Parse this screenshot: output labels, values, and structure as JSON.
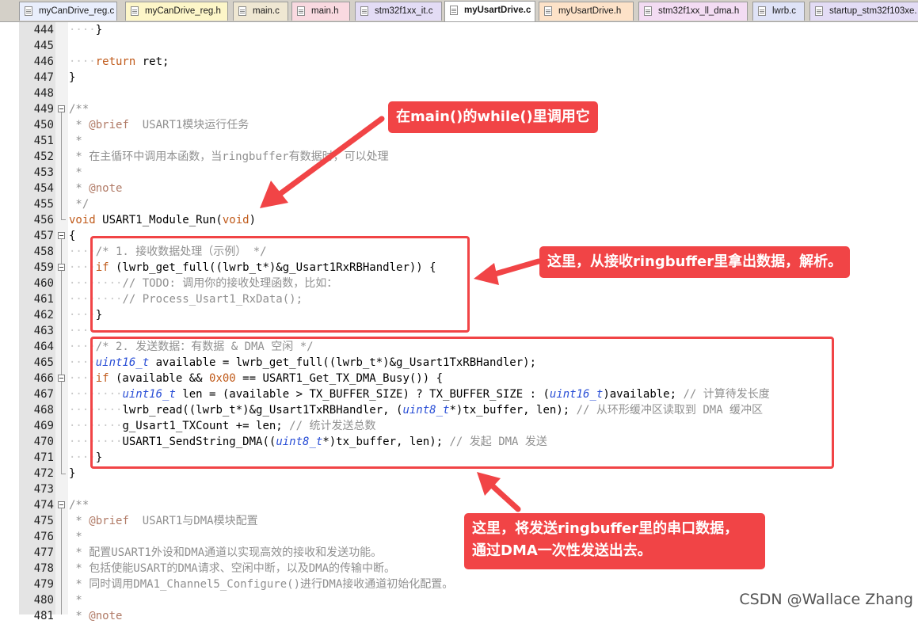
{
  "tabs": [
    {
      "label": "myCanDrive_reg.c",
      "color": "#e9eefc",
      "active": false
    },
    {
      "label": "myCanDrive_reg.h",
      "color": "#fdf6c8",
      "active": false
    },
    {
      "label": "main.c",
      "color": "#efe7d2",
      "active": false
    },
    {
      "label": "main.h",
      "color": "#f9d9e0",
      "active": false
    },
    {
      "label": "stm32f1xx_it.c",
      "color": "#e3dcf5",
      "active": false
    },
    {
      "label": "myUsartDrive.c",
      "color": "#ffffff",
      "active": true
    },
    {
      "label": "myUsartDrive.h",
      "color": "#fde2c8",
      "active": false
    },
    {
      "label": "stm32f1xx_ll_dma.h",
      "color": "#f3dcf3",
      "active": false
    },
    {
      "label": "lwrb.c",
      "color": "#dfe3f7",
      "active": false
    },
    {
      "label": "startup_stm32f103xe.",
      "color": "#e3dcf5",
      "active": false
    }
  ],
  "lines": [
    {
      "n": "444"
    },
    {
      "n": "445"
    },
    {
      "n": "446"
    },
    {
      "n": "447"
    },
    {
      "n": "448"
    },
    {
      "n": "449"
    },
    {
      "n": "450"
    },
    {
      "n": "451"
    },
    {
      "n": "452"
    },
    {
      "n": "453"
    },
    {
      "n": "454"
    },
    {
      "n": "455"
    },
    {
      "n": "456"
    },
    {
      "n": "457"
    },
    {
      "n": "458"
    },
    {
      "n": "459"
    },
    {
      "n": "460"
    },
    {
      "n": "461"
    },
    {
      "n": "462"
    },
    {
      "n": "463"
    },
    {
      "n": "464"
    },
    {
      "n": "465"
    },
    {
      "n": "466"
    },
    {
      "n": "467"
    },
    {
      "n": "468"
    },
    {
      "n": "469"
    },
    {
      "n": "470"
    },
    {
      "n": "471"
    },
    {
      "n": "472"
    },
    {
      "n": "473"
    },
    {
      "n": "474"
    },
    {
      "n": "475"
    },
    {
      "n": "476"
    },
    {
      "n": "477"
    },
    {
      "n": "478"
    },
    {
      "n": "479"
    },
    {
      "n": "480"
    },
    {
      "n": "481"
    }
  ],
  "code": {
    "l444": [
      "}"
    ],
    "l446": [
      "return",
      " ret;"
    ],
    "l447": [
      "}"
    ],
    "l449": [
      "/**"
    ],
    "l450": [
      " * ",
      "@brief",
      "  USART1模块运行任务"
    ],
    "l451": [
      " *"
    ],
    "l452": [
      " * 在主循环中调用本函数，当ringbuffer有数据时，可以处理"
    ],
    "l453": [
      " *"
    ],
    "l454": [
      " * ",
      "@note"
    ],
    "l455": [
      " */"
    ],
    "l456": [
      "void",
      " USART1_Module_Run(",
      "void",
      ")"
    ],
    "l457": [
      "{"
    ],
    "l458": [
      "/* 1. 接收数据处理（示例） */"
    ],
    "l459": [
      "if",
      " (lwrb_get_full((lwrb_t*)&g_Usart1RxRBHandler)) {"
    ],
    "l460": [
      "// TODO: 调用你的接收处理函数，比如："
    ],
    "l461": [
      "// Process_Usart1_RxData();"
    ],
    "l462": [
      "}"
    ],
    "l464": [
      "/* 2. 发送数据：有数据 & DMA 空闲 */"
    ],
    "l465": [
      "uint16_t",
      " available = lwrb_get_full((lwrb_t*)&g_Usart1TxRBHandler);"
    ],
    "l466": [
      "if",
      " (available && ",
      "0x00",
      " == USART1_Get_TX_DMA_Busy()) {"
    ],
    "l467": [
      "uint16_t",
      " len = (available > TX_BUFFER_SIZE) ? TX_BUFFER_SIZE : (",
      "uint16_t",
      ")available; ",
      "// 计算待发长度"
    ],
    "l468": [
      "lwrb_read((lwrb_t*)&g_Usart1TxRBHandler, (",
      "uint8_t",
      "*)tx_buffer, len); ",
      "// 从环形缓冲区读取到 DMA 缓冲区"
    ],
    "l469": [
      "g_Usart1_TXCount += len; ",
      "// 统计发送总数"
    ],
    "l470": [
      "USART1_SendString_DMA((",
      "uint8_t",
      "*)tx_buffer, len); ",
      "// 发起 DMA 发送"
    ],
    "l471": [
      "}"
    ],
    "l472": [
      "}"
    ],
    "l474": [
      "/**"
    ],
    "l475": [
      " * ",
      "@brief",
      "  USART1与DMA模块配置"
    ],
    "l476": [
      " *"
    ],
    "l477": [
      " * 配置USART1外设和DMA通道以实现高效的接收和发送功能。"
    ],
    "l478": [
      " * 包括使能USART的DMA请求、空闲中断，以及DMA的传输中断。"
    ],
    "l479": [
      " * 同时调用DMA1_Channel5_Configure()进行DMA接收通道初始化配置。"
    ],
    "l480": [
      " *"
    ],
    "l481": [
      " * ",
      "@note"
    ]
  },
  "annotations": {
    "callout1": "在main()的while()里调用它",
    "callout2": "这里，从接收ringbuffer里拿出数据，解析。",
    "callout3_line1": "这里，将发送ringbuffer里的串口数据，",
    "callout3_line2": "通过DMA一次性发送出去。",
    "accent_color": "#f14446"
  },
  "watermark": "CSDN @Wallace Zhang"
}
